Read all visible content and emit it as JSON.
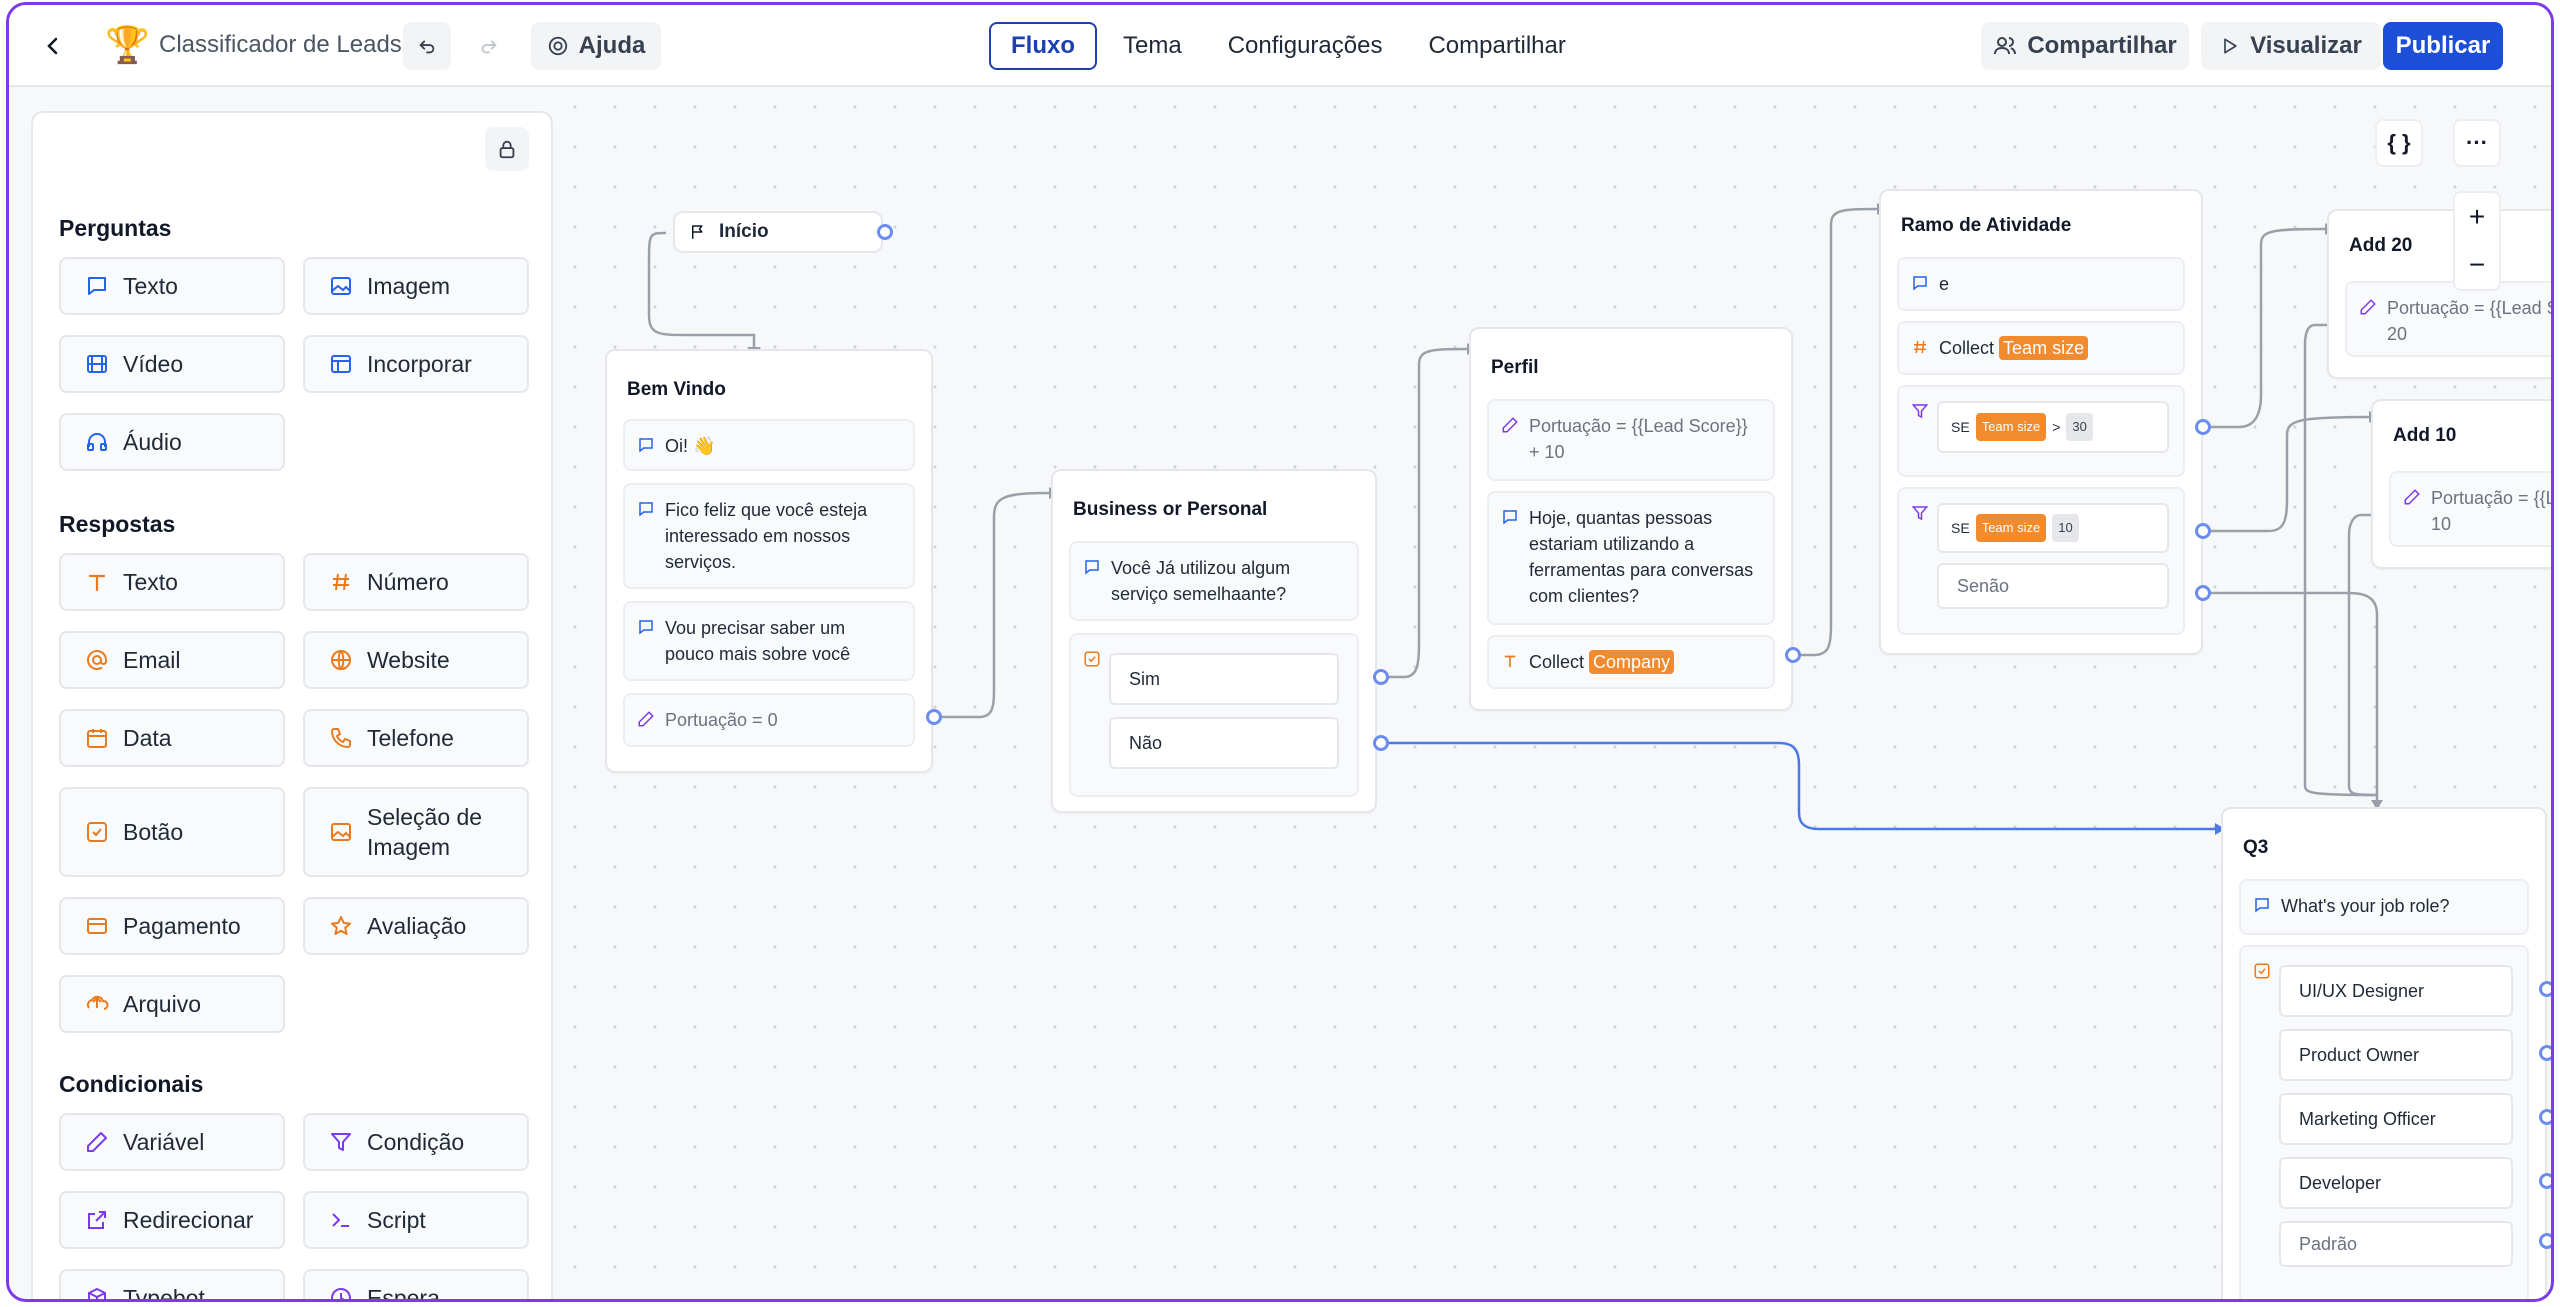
{
  "app": {
    "title": "Classificador de Leads",
    "help_label": "Ajuda",
    "share_label": "Compartilhar",
    "preview_label": "Visualizar",
    "publish_label": "Publicar"
  },
  "tabs": [
    {
      "label": "Fluxo",
      "active": true
    },
    {
      "label": "Tema",
      "active": false
    },
    {
      "label": "Configurações",
      "active": false
    },
    {
      "label": "Compartilhar",
      "active": false
    }
  ],
  "sidebar": {
    "sections": {
      "questions": "Perguntas",
      "answers": "Respostas",
      "conditionals": "Condicionais"
    },
    "questions": [
      "Texto",
      "Imagem",
      "Vídeo",
      "Incorporar",
      "Áudio"
    ],
    "answers": [
      "Texto",
      "Número",
      "Email",
      "Website",
      "Data",
      "Telefone",
      "Botão",
      "Seleção de Imagem",
      "Pagamento",
      "Avaliação",
      "Arquivo"
    ],
    "conditionals": [
      "Variável",
      "Condição",
      "Redirecionar",
      "Script",
      "Typebot",
      "Espera"
    ]
  },
  "canvas": {
    "controls": {
      "code": "{ }",
      "more": "···",
      "zoom_in": "+",
      "zoom_out": "−"
    },
    "start_label": "Início",
    "bem_vindo": {
      "title": "Bem Vindo",
      "msg1": "Oi! 👋",
      "msg2": "Fico feliz que você esteja interessado em nossos serviços.",
      "msg3": "Vou precisar saber um pouco mais sobre você",
      "var": "Portuação = 0"
    },
    "business": {
      "title": "Business or Personal",
      "question": "Você Já utilizou algum serviço semelhaante?",
      "opt1": "Sim",
      "opt2": "Não"
    },
    "perfil": {
      "title": "Perfil",
      "var": "Portuação = {{Lead Score}} + 10",
      "question": "Hoje, quantas pessoas estariam utilizando a ferramentas para conversas com clientes?",
      "collect_label": "Collect",
      "collect_var": "Company"
    },
    "ramo": {
      "title": "Ramo de Atividade",
      "msg": "e",
      "collect_label": "Collect",
      "collect_var": "Team size",
      "cond1_prefix": "SE",
      "cond1_var": "Team size",
      "cond1_op": ">",
      "cond1_val": "30",
      "cond2_prefix": "SE",
      "cond2_var": "Team size",
      "cond2_val": "10",
      "else": "Senão"
    },
    "add20": {
      "title": "Add 20",
      "var": "Portuação = {{Lead Sc",
      "var2": "20"
    },
    "add10": {
      "title": "Add 10",
      "var": "Portuação = {{Le",
      "var2": "10"
    },
    "q3": {
      "title": "Q3",
      "question": "What's your job role?",
      "options": [
        "UI/UX Designer",
        "Product Owner",
        "Marketing Officer",
        "Developer"
      ],
      "default": "Padrão"
    }
  }
}
